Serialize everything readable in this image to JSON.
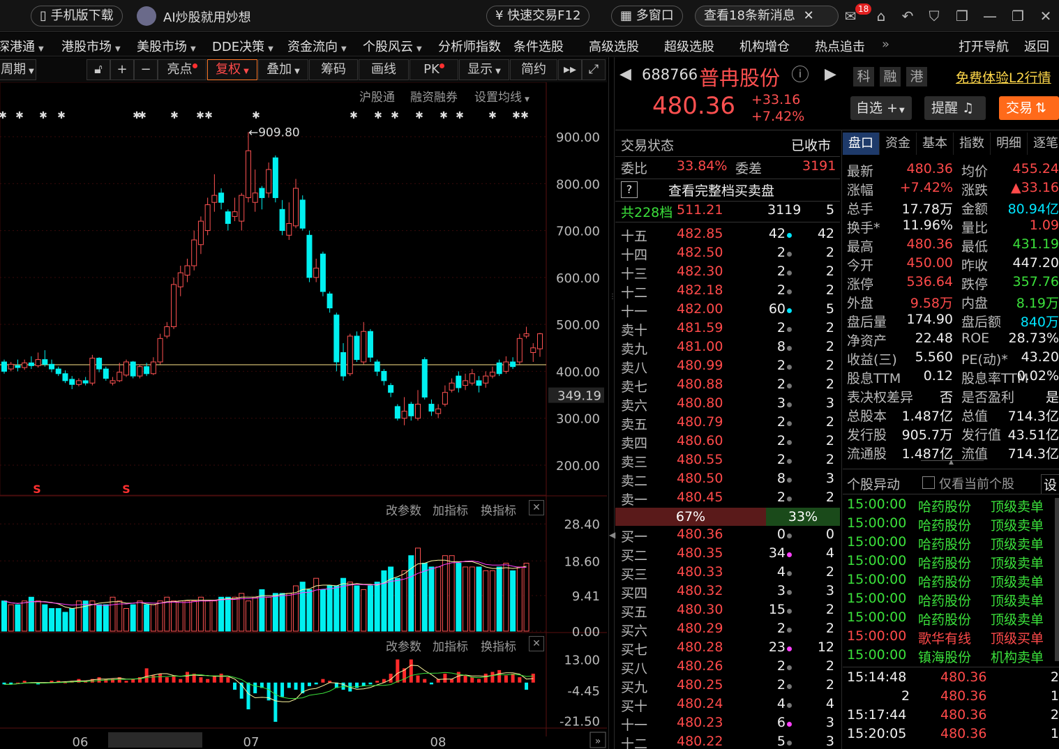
{
  "topbar": {
    "mobile_download": "手机版下载",
    "ai_promo": "AI炒股就用妙想",
    "quick_trade": "快速交易F12",
    "multi_window": "多窗口",
    "news": "查看18条新消息",
    "mail_badge": "18"
  },
  "nav": {
    "items": [
      "深港通",
      "港股市场",
      "美股市场",
      "DDE决策",
      "资金流向",
      "个股风云",
      "分析师指数",
      "条件选股",
      "高级选股",
      "超级选股",
      "机构增仓",
      "热点追击"
    ],
    "open_nav": "打开导航",
    "back": "返回"
  },
  "toolbar": {
    "period": "周期",
    "highlight": "亮点",
    "restore_rights": "复权",
    "overlay": "叠加",
    "chips": "筹码",
    "draw": "画线",
    "pk": "PK",
    "display": "显示",
    "brief": "简约"
  },
  "chart_links": {
    "hgt": "沪股通",
    "margin": "融资融券",
    "set_ma": "设置均线"
  },
  "sub_links": {
    "change_params": "改参数",
    "add_indicator": "加指标",
    "swap_indicator": "换指标"
  },
  "chart_data": {
    "type": "candlestick",
    "main": {
      "y_ticks": [
        "900.00",
        "800.00",
        "700.00",
        "600.00",
        "500.00",
        "400.00",
        "300.00",
        "200.00"
      ],
      "ylim": [
        200,
        900
      ],
      "high_annotation": "909.80",
      "price_tag": "349.19",
      "reference_line": 414,
      "x_labels": [
        "06",
        "07",
        "08"
      ],
      "candles": [
        {
          "o": 420,
          "c": 400,
          "h": 425,
          "l": 395
        },
        {
          "o": 405,
          "c": 415,
          "h": 420,
          "l": 400
        },
        {
          "o": 412,
          "c": 408,
          "h": 425,
          "l": 400
        },
        {
          "o": 408,
          "c": 418,
          "h": 425,
          "l": 403
        },
        {
          "o": 418,
          "c": 412,
          "h": 432,
          "l": 405
        },
        {
          "o": 412,
          "c": 425,
          "h": 440,
          "l": 408
        },
        {
          "o": 425,
          "c": 415,
          "h": 445,
          "l": 410
        },
        {
          "o": 415,
          "c": 405,
          "h": 425,
          "l": 398
        },
        {
          "o": 405,
          "c": 395,
          "h": 410,
          "l": 390
        },
        {
          "o": 395,
          "c": 380,
          "h": 402,
          "l": 375
        },
        {
          "o": 383,
          "c": 372,
          "h": 390,
          "l": 362
        },
        {
          "o": 372,
          "c": 380,
          "h": 385,
          "l": 368
        },
        {
          "o": 380,
          "c": 375,
          "h": 388,
          "l": 370
        },
        {
          "o": 375,
          "c": 428,
          "h": 435,
          "l": 370
        },
        {
          "o": 428,
          "c": 405,
          "h": 430,
          "l": 398
        },
        {
          "o": 405,
          "c": 385,
          "h": 410,
          "l": 380
        },
        {
          "o": 375,
          "c": 380,
          "h": 388,
          "l": 370
        },
        {
          "o": 380,
          "c": 398,
          "h": 418,
          "l": 377
        },
        {
          "o": 392,
          "c": 420,
          "h": 425,
          "l": 388
        },
        {
          "o": 420,
          "c": 390,
          "h": 422,
          "l": 385
        },
        {
          "o": 390,
          "c": 410,
          "h": 415,
          "l": 385
        },
        {
          "o": 410,
          "c": 395,
          "h": 418,
          "l": 390
        },
        {
          "o": 395,
          "c": 420,
          "h": 430,
          "l": 392
        },
        {
          "o": 420,
          "c": 470,
          "h": 480,
          "l": 415
        },
        {
          "o": 475,
          "c": 495,
          "h": 505,
          "l": 470
        },
        {
          "o": 495,
          "c": 585,
          "h": 600,
          "l": 490
        },
        {
          "o": 580,
          "c": 610,
          "h": 625,
          "l": 560
        },
        {
          "o": 605,
          "c": 625,
          "h": 640,
          "l": 590
        },
        {
          "o": 625,
          "c": 680,
          "h": 700,
          "l": 615
        },
        {
          "o": 670,
          "c": 720,
          "h": 730,
          "l": 650
        },
        {
          "o": 700,
          "c": 755,
          "h": 770,
          "l": 690
        },
        {
          "o": 760,
          "c": 775,
          "h": 820,
          "l": 740
        },
        {
          "o": 780,
          "c": 760,
          "h": 790,
          "l": 745
        },
        {
          "o": 740,
          "c": 715,
          "h": 745,
          "l": 700
        },
        {
          "o": 730,
          "c": 740,
          "h": 770,
          "l": 720
        },
        {
          "o": 720,
          "c": 775,
          "h": 780,
          "l": 700
        },
        {
          "o": 770,
          "c": 870,
          "h": 909.8,
          "l": 760
        },
        {
          "o": 760,
          "c": 780,
          "h": 830,
          "l": 740
        },
        {
          "o": 790,
          "c": 770,
          "h": 795,
          "l": 745
        },
        {
          "o": 780,
          "c": 830,
          "h": 845,
          "l": 770
        },
        {
          "o": 855,
          "c": 770,
          "h": 860,
          "l": 760
        },
        {
          "o": 745,
          "c": 700,
          "h": 765,
          "l": 690
        },
        {
          "o": 690,
          "c": 715,
          "h": 760,
          "l": 680
        },
        {
          "o": 710,
          "c": 790,
          "h": 810,
          "l": 705
        },
        {
          "o": 765,
          "c": 705,
          "h": 775,
          "l": 700
        },
        {
          "o": 690,
          "c": 600,
          "h": 700,
          "l": 590
        },
        {
          "o": 600,
          "c": 620,
          "h": 640,
          "l": 590
        },
        {
          "o": 650,
          "c": 570,
          "h": 655,
          "l": 560
        },
        {
          "o": 565,
          "c": 535,
          "h": 570,
          "l": 525
        },
        {
          "o": 520,
          "c": 420,
          "h": 525,
          "l": 400
        },
        {
          "o": 440,
          "c": 390,
          "h": 460,
          "l": 380
        },
        {
          "o": 395,
          "c": 475,
          "h": 480,
          "l": 390
        },
        {
          "o": 475,
          "c": 425,
          "h": 485,
          "l": 420
        },
        {
          "o": 420,
          "c": 485,
          "h": 505,
          "l": 415
        },
        {
          "o": 485,
          "c": 430,
          "h": 490,
          "l": 420
        },
        {
          "o": 420,
          "c": 400,
          "h": 425,
          "l": 390
        },
        {
          "o": 400,
          "c": 380,
          "h": 405,
          "l": 370
        },
        {
          "o": 370,
          "c": 355,
          "h": 375,
          "l": 345
        },
        {
          "o": 325,
          "c": 300,
          "h": 330,
          "l": 295
        },
        {
          "o": 300,
          "c": 315,
          "h": 345,
          "l": 285
        },
        {
          "o": 330,
          "c": 305,
          "h": 335,
          "l": 295
        },
        {
          "o": 300,
          "c": 330,
          "h": 360,
          "l": 295
        },
        {
          "o": 425,
          "c": 345,
          "h": 430,
          "l": 340
        },
        {
          "o": 330,
          "c": 315,
          "h": 340,
          "l": 305
        },
        {
          "o": 310,
          "c": 320,
          "h": 330,
          "l": 300
        },
        {
          "o": 330,
          "c": 355,
          "h": 370,
          "l": 325
        },
        {
          "o": 360,
          "c": 375,
          "h": 385,
          "l": 355
        },
        {
          "o": 390,
          "c": 365,
          "h": 400,
          "l": 355
        },
        {
          "o": 370,
          "c": 380,
          "h": 395,
          "l": 360
        },
        {
          "o": 375,
          "c": 395,
          "h": 405,
          "l": 370
        },
        {
          "o": 380,
          "c": 370,
          "h": 390,
          "l": 355
        },
        {
          "o": 375,
          "c": 390,
          "h": 400,
          "l": 365
        },
        {
          "o": 390,
          "c": 398,
          "h": 410,
          "l": 385
        },
        {
          "o": 418,
          "c": 395,
          "h": 425,
          "l": 390
        },
        {
          "o": 400,
          "c": 420,
          "h": 432,
          "l": 395
        },
        {
          "o": 420,
          "c": 410,
          "h": 430,
          "l": 405
        },
        {
          "o": 420,
          "c": 470,
          "h": 480,
          "l": 415
        },
        {
          "o": 475,
          "c": 480,
          "h": 495,
          "l": 470
        },
        {
          "o": 440,
          "c": 450,
          "h": 460,
          "l": 420
        },
        {
          "o": 448,
          "c": 480,
          "h": 482,
          "l": 431
        }
      ]
    },
    "volume": {
      "y_ticks": [
        "28.40",
        "18.60",
        "9.41",
        "0.00"
      ],
      "ylim": [
        0,
        29
      ],
      "values": [
        8,
        7,
        7,
        8,
        9,
        8,
        7,
        6,
        6,
        5,
        6,
        8,
        8,
        8,
        7,
        7,
        9,
        8,
        6,
        7,
        8,
        7,
        7,
        8,
        9,
        8,
        8,
        8,
        8,
        9,
        8,
        8,
        9,
        9,
        9,
        10,
        8,
        9,
        11,
        9,
        10,
        10,
        10,
        12,
        13,
        11,
        14,
        11,
        12,
        12,
        14,
        13,
        12,
        11,
        12,
        13,
        16,
        17,
        14,
        16,
        20,
        22,
        18,
        17,
        17,
        20,
        20,
        18,
        17,
        17,
        17,
        16,
        16,
        17,
        18,
        16,
        17,
        18
      ]
    },
    "macd": {
      "y_ticks": [
        "13.00",
        "-4.45",
        "-21.50"
      ],
      "ylim": [
        -22,
        14
      ],
      "values": [
        -1,
        -1,
        0,
        1,
        0,
        -1,
        0,
        1,
        1,
        0,
        1,
        2,
        1,
        2,
        3,
        2,
        2,
        3,
        1,
        2,
        3,
        8,
        4,
        5,
        3,
        4,
        2,
        6,
        5,
        3,
        2,
        4,
        5,
        3,
        -4,
        -9,
        -15,
        -6,
        -3,
        -10,
        -22,
        -8,
        -3,
        -4,
        -6,
        -2,
        -1,
        2,
        1,
        -3,
        -4,
        -5,
        -3,
        -2,
        -1,
        1,
        2,
        5,
        13,
        8,
        13,
        4,
        2,
        -1,
        2,
        5,
        2,
        6,
        4,
        3,
        2,
        5,
        6,
        7,
        4,
        5,
        3,
        -4,
        5
      ]
    }
  },
  "stock": {
    "code": "688766",
    "name": "普冉股份",
    "price": "480.36",
    "change": "+33.16",
    "change_pct": "+7.42%",
    "tags": [
      "科",
      "融",
      "港"
    ],
    "l2_link": "免费体验L2行情",
    "watchlist": "自选",
    "remind": "提醒",
    "trade": "交易"
  },
  "orderbook": {
    "status_label": "交易状态",
    "status_value": "已收市",
    "ratio_label": "委比",
    "ratio_value": "33.84%",
    "diff_label": "委差",
    "diff_value": "3191",
    "full_depth": "查看完整档买卖盘",
    "summary": [
      "共228档",
      "511.21",
      "3119",
      "5"
    ],
    "sell": [
      [
        "十五",
        "482.85",
        "42",
        "cyan",
        "42"
      ],
      [
        "十四",
        "482.50",
        "2",
        "gray",
        "2"
      ],
      [
        "十三",
        "482.30",
        "2",
        "gray",
        "2"
      ],
      [
        "十二",
        "482.18",
        "2",
        "gray",
        "2"
      ],
      [
        "十一",
        "482.00",
        "60",
        "cyan",
        "5"
      ],
      [
        "卖十",
        "481.59",
        "2",
        "gray",
        "2"
      ],
      [
        "卖九",
        "481.00",
        "8",
        "gray",
        "2"
      ],
      [
        "卖八",
        "480.99",
        "2",
        "gray",
        "2"
      ],
      [
        "卖七",
        "480.88",
        "2",
        "gray",
        "2"
      ],
      [
        "卖六",
        "480.80",
        "3",
        "gray",
        "3"
      ],
      [
        "卖五",
        "480.79",
        "2",
        "gray",
        "2"
      ],
      [
        "卖四",
        "480.60",
        "2",
        "gray",
        "2"
      ],
      [
        "卖三",
        "480.55",
        "2",
        "gray",
        "2"
      ],
      [
        "卖二",
        "480.50",
        "8",
        "gray",
        "3"
      ],
      [
        "卖一",
        "480.45",
        "2",
        "gray",
        "2"
      ]
    ],
    "bar_left": "67%",
    "bar_right": "33%",
    "buy": [
      [
        "买一",
        "480.36",
        "0",
        "gray",
        "0"
      ],
      [
        "买二",
        "480.35",
        "34",
        "magenta",
        "4"
      ],
      [
        "买三",
        "480.33",
        "4",
        "gray",
        "2"
      ],
      [
        "买四",
        "480.32",
        "3",
        "gray",
        "3"
      ],
      [
        "买五",
        "480.30",
        "15",
        "gray",
        "2"
      ],
      [
        "买六",
        "480.29",
        "2",
        "gray",
        "2"
      ],
      [
        "买七",
        "480.28",
        "23",
        "magenta",
        "12"
      ],
      [
        "买八",
        "480.26",
        "2",
        "gray",
        "2"
      ],
      [
        "买九",
        "480.25",
        "2",
        "gray",
        "2"
      ],
      [
        "买十",
        "480.24",
        "4",
        "gray",
        "4"
      ],
      [
        "十一",
        "480.23",
        "6",
        "magenta",
        "3"
      ],
      [
        "十二",
        "480.22",
        "5",
        "gray",
        "3"
      ]
    ]
  },
  "tabs": [
    "盘口",
    "资金",
    "基本",
    "指数",
    "明细",
    "逐笔"
  ],
  "quote": [
    [
      "最新",
      "480.36",
      "red",
      "均价",
      "455.24",
      "red"
    ],
    [
      "涨幅",
      "+7.42%",
      "red",
      "涨跌",
      "▲33.16",
      "red"
    ],
    [
      "总手",
      "17.78万",
      "white",
      "金额",
      "80.94亿",
      "cyan"
    ],
    [
      "换手*",
      "11.96%",
      "white",
      "量比",
      "1.09",
      "red"
    ],
    [
      "最高",
      "480.36",
      "red",
      "最低",
      "431.19",
      "green"
    ],
    [
      "今开",
      "450.00",
      "red",
      "昨收",
      "447.20",
      "white"
    ],
    [
      "涨停",
      "536.64",
      "red",
      "跌停",
      "357.76",
      "green"
    ],
    [
      "外盘",
      "9.58万",
      "red",
      "内盘",
      "8.19万",
      "green"
    ],
    [
      "盘后量",
      "174.90",
      "white",
      "盘后额",
      "840万",
      "cyan"
    ],
    [
      "净资产",
      "22.48",
      "white",
      "ROE",
      "28.73%",
      "white"
    ],
    [
      "收益(三)",
      "5.560",
      "white",
      "PE(动)*",
      "43.20",
      "white"
    ],
    [
      "股息TTM",
      "0.12",
      "white",
      "股息率TTM",
      "0.02%",
      "white"
    ],
    [
      "表决权差异",
      "否",
      "white",
      "是否盈利",
      "是",
      "white"
    ],
    [
      "总股本",
      "1.487亿",
      "white",
      "总值",
      "714.3亿",
      "white"
    ],
    [
      "发行股",
      "905.7万",
      "white",
      "发行值",
      "43.51亿",
      "white"
    ],
    [
      "流通股",
      "1.487亿",
      "white",
      "流值",
      "714.3亿",
      "white"
    ]
  ],
  "movement": {
    "title": "个股异动",
    "only_current": "仅看当前个股",
    "settings": "设",
    "rows": [
      [
        "15:00:00",
        "哈药股份",
        "顶级卖单",
        "green"
      ],
      [
        "15:00:00",
        "哈药股份",
        "顶级卖单",
        "green"
      ],
      [
        "15:00:00",
        "哈药股份",
        "顶级卖单",
        "green"
      ],
      [
        "15:00:00",
        "哈药股份",
        "顶级卖单",
        "green"
      ],
      [
        "15:00:00",
        "哈药股份",
        "顶级卖单",
        "green"
      ],
      [
        "15:00:00",
        "哈药股份",
        "顶级卖单",
        "green"
      ],
      [
        "15:00:00",
        "哈药股份",
        "顶级卖单",
        "green"
      ],
      [
        "15:00:00",
        "歌华有线",
        "顶级买单",
        "red"
      ],
      [
        "15:00:00",
        "镇海股份",
        "机构卖单",
        "green"
      ]
    ]
  },
  "ticks": [
    [
      "15:14:48",
      "480.36",
      "2"
    ],
    [
      "2",
      "480.36",
      "1"
    ],
    [
      "15:17:44",
      "480.36",
      "2"
    ],
    [
      "15:20:05",
      "480.36",
      "1"
    ]
  ]
}
